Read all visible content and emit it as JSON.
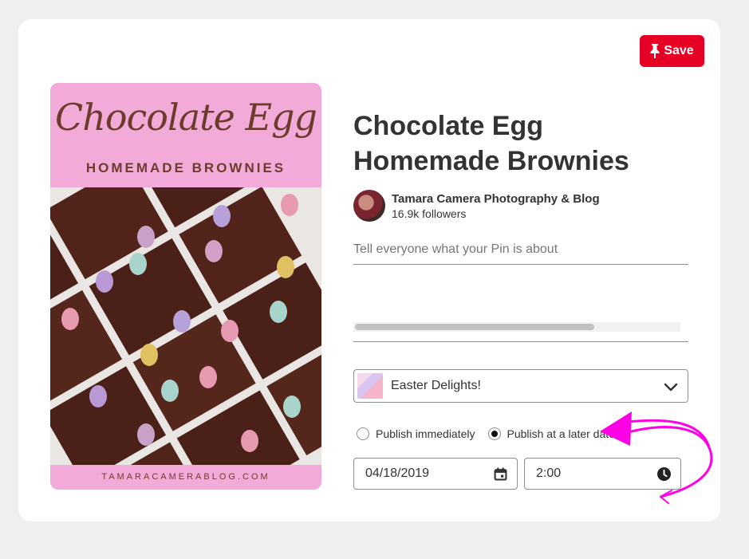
{
  "save_button": {
    "label": "Save",
    "icon": "pushpin-icon"
  },
  "pin_image": {
    "headline": "Chocolate Egg",
    "subline": "HOMEMADE BROWNIES",
    "footer": "TAMARACAMERABLOG.COM"
  },
  "pin": {
    "title": "Chocolate Egg Homemade Brownies",
    "author": "Tamara Camera Photography & Blog",
    "followers": "16.9k followers"
  },
  "description": {
    "placeholder": "Tell everyone what your Pin is about"
  },
  "board": {
    "selected": "Easter Delights!"
  },
  "publish": {
    "option_immediately": "Publish immediately",
    "option_later": "Publish at a later date",
    "selected": "later"
  },
  "schedule": {
    "date": "04/18/2019",
    "time": "2:00"
  },
  "colors": {
    "save_red": "#e60023",
    "annotation_magenta": "#ff00e6",
    "pin_pink": "#f2abd9"
  }
}
